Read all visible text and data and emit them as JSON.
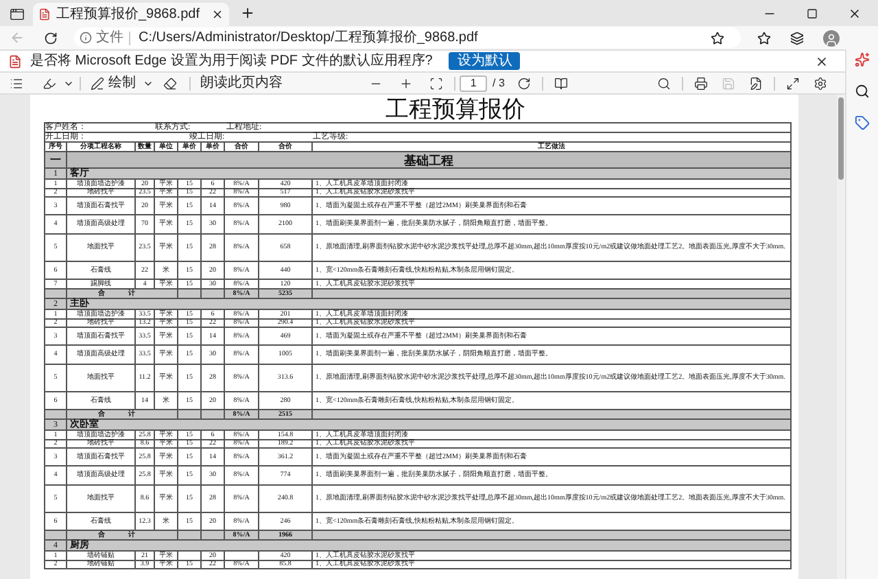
{
  "tab": {
    "title": "工程预算报价_9868.pdf"
  },
  "address": {
    "scheme": "文件",
    "url": "C:/Users/Administrator/Desktop/工程预算报价_9868.pdf"
  },
  "infobar": {
    "message": "是否将 Microsoft Edge 设置为用于阅读 PDF 文件的默认应用程序?",
    "button": "设为默认"
  },
  "pdf_toolbar": {
    "draw": "绘制",
    "read_aloud": "朗读此页内容",
    "page": "1",
    "page_count": "/ 3"
  },
  "document": {
    "title": "工程预算报价",
    "info_rows": [
      [
        "客户姓名：",
        "联系方式:",
        "工程地址:"
      ],
      [
        "开工日期：",
        "竣工日期:",
        "工艺等级:"
      ]
    ],
    "columns": [
      "序号",
      "分项工程名称",
      "数量",
      "单位",
      "单价",
      "单价",
      "合价",
      "合价",
      "工艺做法"
    ],
    "section": {
      "number": "一",
      "title": "基础工程"
    },
    "groups": [
      {
        "number": "1",
        "name": "客厅",
        "rows": [
          [
            "1",
            "墙顶面墙边护漆",
            "20",
            "平米",
            "15",
            "6",
            "8%/A",
            "420",
            "1、人工机具皮革墙顶面封闭漆"
          ],
          [
            "2",
            "地砖找平",
            "23.5",
            "平米",
            "15",
            "22",
            "8%/A",
            "517",
            "1、人工机具皮钻胶水泥砂浆找平"
          ],
          [
            "3",
            "墙顶面石膏找平",
            "20",
            "平米",
            "15",
            "14",
            "8%/A",
            "980",
            "1、墙面为凝固土或存在严重不平整（超过2MM）刷美巢界面剂和石膏"
          ],
          [
            "4",
            "墙顶面高级处理",
            "70",
            "平米",
            "15",
            "30",
            "8%/A",
            "2100",
            "1、墙面刷美巢界面剂一遍，批刮美巢防水腻子，阴阳角顺直打磨，墙面平整。"
          ],
          [
            "5",
            "地面找平",
            "23.5",
            "平米",
            "15",
            "28",
            "8%/A",
            "658",
            "1、原地面清理,刷界面剂钻胶水泥中砂水泥沙浆找平处理,总厚不超30mm,超出10mm厚度按10元/m2或建议做地面处理工艺2。地面表面压光,厚度不大于30mm."
          ],
          [
            "6",
            "石膏线",
            "22",
            "米",
            "15",
            "20",
            "8%/A",
            "440",
            "1、宽<120mm条石膏雕刻石膏线,快粘粉粘贴,木制条层用钢钉固定。"
          ],
          [
            "7",
            "踢脚线",
            "4",
            "平米",
            "15",
            "30",
            "8%/A",
            "120",
            "1、人工机具皮钻胶水泥砂浆找平"
          ]
        ],
        "total": {
          "label": "合 计",
          "rate": "8%/A",
          "amount": "5235"
        }
      },
      {
        "number": "2",
        "name": "主卧",
        "rows": [
          [
            "1",
            "墙顶面墙边护漆",
            "33.5",
            "平米",
            "15",
            "6",
            "8%/A",
            "201",
            "1、人工机具皮革墙顶面封闭漆"
          ],
          [
            "2",
            "地砖找平",
            "13.2",
            "平米",
            "15",
            "22",
            "8%/A",
            "290.4",
            "1、人工机具皮钻胶水泥砂浆找平"
          ],
          [
            "3",
            "墙顶面石膏找平",
            "33.5",
            "平米",
            "15",
            "14",
            "8%/A",
            "469",
            "1、墙面为凝固土或存在严重不平整（超过2MM）刷美巢界面剂和石膏"
          ],
          [
            "4",
            "墙顶面高级处理",
            "33.5",
            "平米",
            "15",
            "30",
            "8%/A",
            "1005",
            "1、墙面刷美巢界面剂一遍，批刮美巢防水腻子，阴阳角顺直打磨，墙面平整。"
          ],
          [
            "5",
            "地面找平",
            "11.2",
            "平米",
            "15",
            "28",
            "8%/A",
            "313.6",
            "1、原地面清理,刷界面剂钻胶水泥中砂水泥沙浆找平处理,总厚不超30mm,超出10mm厚度按10元/m2或建议做地面处理工艺2。地面表面压光,厚度不大于30mm."
          ],
          [
            "6",
            "石膏线",
            "14",
            "米",
            "15",
            "20",
            "8%/A",
            "280",
            "1、宽<120mm条石膏雕刻石膏线,快粘粉粘贴,木制条层用钢钉固定。"
          ]
        ],
        "total": {
          "label": "合 计",
          "rate": "8%/A",
          "amount": "2515"
        }
      },
      {
        "number": "3",
        "name": "次卧室",
        "rows": [
          [
            "1",
            "墙顶面墙边护漆",
            "25.8",
            "平米",
            "15",
            "6",
            "8%/A",
            "154.8",
            "1、人工机具皮革墙顶面封闭漆"
          ],
          [
            "2",
            "地砖找平",
            "8.6",
            "平米",
            "15",
            "22",
            "8%/A",
            "189.2",
            "1、人工机具皮钻胶水泥砂浆找平"
          ],
          [
            "3",
            "墙顶面石膏找平",
            "25.8",
            "平米",
            "15",
            "14",
            "8%/A",
            "361.2",
            "1、墙面为凝固土或存在严重不平整（超过2MM）刷美巢界面剂和石膏"
          ],
          [
            "4",
            "墙顶面高级处理",
            "25.8",
            "平米",
            "15",
            "30",
            "8%/A",
            "774",
            "1、墙面刷美巢界面剂一遍，批刮美巢防水腻子，阴阳角顺直打磨，墙面平整。"
          ],
          [
            "5",
            "地面找平",
            "8.6",
            "平米",
            "15",
            "28",
            "8%/A",
            "240.8",
            "1、原地面清理,刷界面剂钻胶水泥中砂水泥沙浆找平处理,总厚不超30mm,超出10mm厚度按10元/m2或建议做地面处理工艺2。地面表面压光,厚度不大于30mm."
          ],
          [
            "6",
            "石膏线",
            "12.3",
            "米",
            "15",
            "20",
            "8%/A",
            "246",
            "1、宽<120mm条石膏雕刻石膏线,快粘粉粘贴,木制条层用钢钉固定。"
          ]
        ],
        "total": {
          "label": "合 计",
          "rate": "8%/A",
          "amount": "1966"
        }
      },
      {
        "number": "4",
        "name": "厨房",
        "rows": [
          [
            "1",
            "墙砖铺贴",
            "21",
            "平米",
            null,
            "20",
            null,
            "420",
            "1、人工机具皮钻胶水泥砂浆找平"
          ],
          [
            "2",
            "地砖铺贴",
            "3.9",
            "平米",
            "15",
            "22",
            "8%/A",
            "85.8",
            "1、人工机具皮钻胶水泥砂浆找平"
          ]
        ]
      }
    ]
  }
}
